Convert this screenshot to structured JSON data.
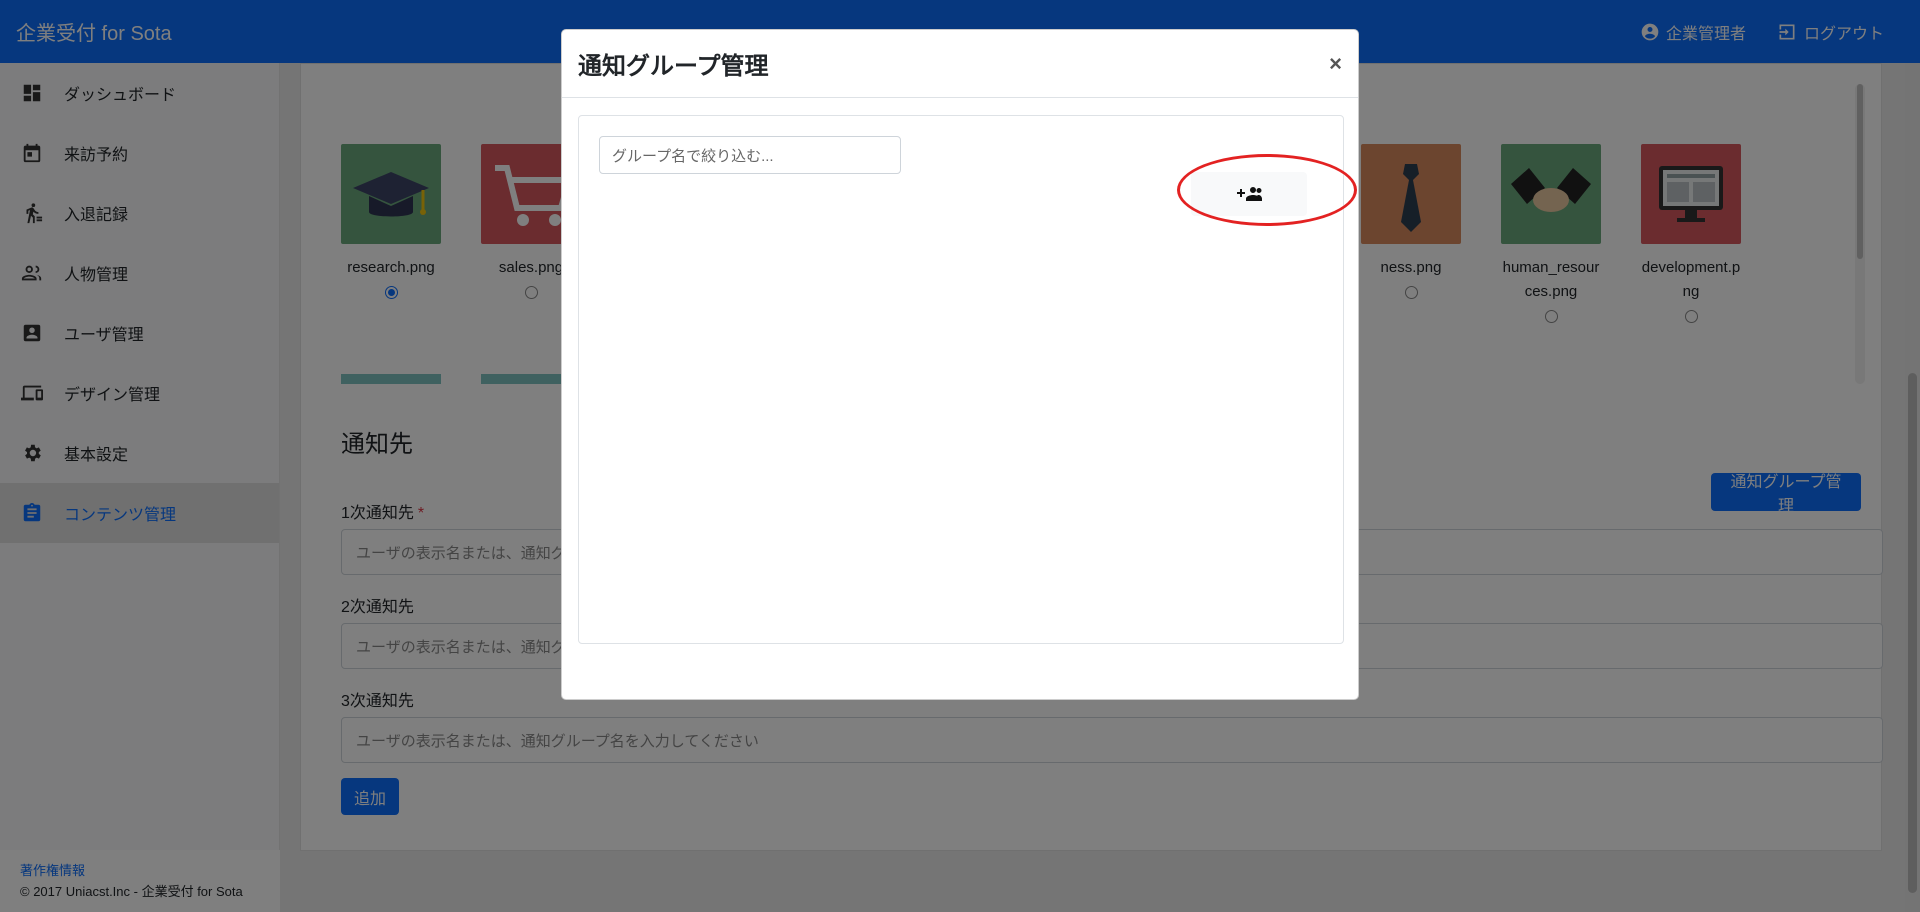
{
  "app": {
    "brand": "企業受付 for Sota",
    "user_label": "企業管理者",
    "logout_label": "ログアウト"
  },
  "sidebar": {
    "items": [
      {
        "label": "ダッシュボード",
        "icon": "dashboard-icon"
      },
      {
        "label": "来訪予約",
        "icon": "calendar-icon"
      },
      {
        "label": "入退記録",
        "icon": "walk-icon"
      },
      {
        "label": "人物管理",
        "icon": "people-icon"
      },
      {
        "label": "ユーザ管理",
        "icon": "account-box-icon"
      },
      {
        "label": "デザイン管理",
        "icon": "devices-icon"
      },
      {
        "label": "基本設定",
        "icon": "gear-icon"
      },
      {
        "label": "コンテンツ管理",
        "icon": "clipboard-icon",
        "active": true
      }
    ],
    "footer_link": "著作権情報",
    "footer_text": "© 2017 Uniacst.Inc - 企業受付 for Sota"
  },
  "icons": [
    {
      "name": "research.png",
      "checked": true
    },
    {
      "name": "sales.png",
      "checked": false
    },
    {
      "name": "business.png",
      "visible_name": "ness.png",
      "checked": false
    },
    {
      "name": "human_resources.png",
      "checked": false
    },
    {
      "name": "development.png",
      "checked": false
    }
  ],
  "notify": {
    "section_title": "通知先",
    "group_button": "通知グループ管理",
    "first_label": "1次通知先",
    "second_label": "2次通知先",
    "third_label": "3次通知先",
    "placeholder_partial": "ユーザの表示名または、通知グ",
    "placeholder_full": "ユーザの表示名または、通知グループ名を入力してください",
    "add_button": "追加"
  },
  "modal": {
    "title": "通知グループ管理",
    "close": "×",
    "filter_placeholder": "グループ名で絞り込む..."
  },
  "colors": {
    "primary": "#0d6efd",
    "highlight": "#e32222"
  }
}
